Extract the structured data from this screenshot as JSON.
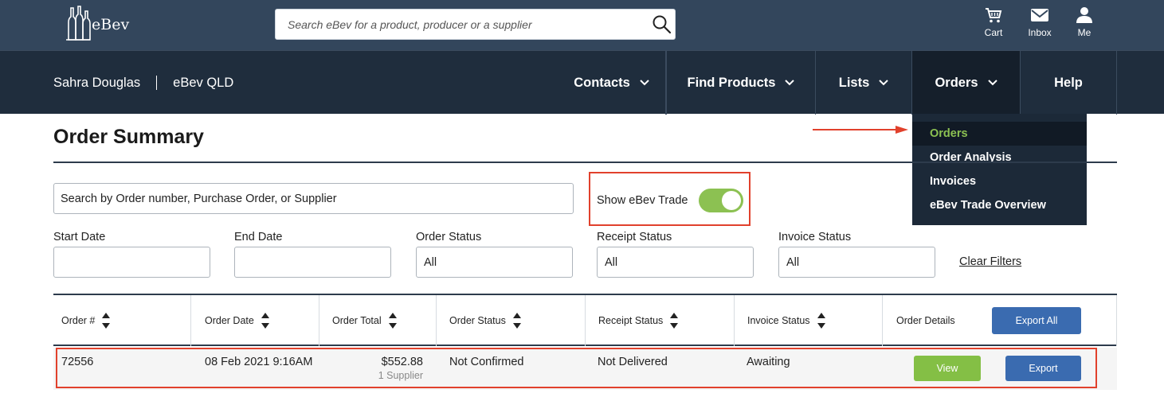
{
  "header": {
    "logo_text": "eBev",
    "search_placeholder": "Search eBev for a product, producer or a supplier",
    "icons": [
      {
        "name": "cart-icon",
        "label": "Cart"
      },
      {
        "name": "inbox-icon",
        "label": "Inbox"
      },
      {
        "name": "me-icon",
        "label": "Me"
      }
    ]
  },
  "nav": {
    "user_name": "Sahra Douglas",
    "company": "eBev QLD",
    "items": [
      {
        "label": "Contacts",
        "has_dropdown": true
      },
      {
        "label": "Find Products",
        "has_dropdown": true
      },
      {
        "label": "Lists",
        "has_dropdown": true
      },
      {
        "label": "Orders",
        "has_dropdown": true,
        "active": true
      },
      {
        "label": "Help",
        "has_dropdown": false
      }
    ],
    "orders_menu": [
      "Orders",
      "Order Analysis",
      "Invoices",
      "eBev Trade Overview"
    ]
  },
  "page": {
    "title": "Order Summary",
    "order_search_placeholder": "Search by Order number, Purchase Order, or Supplier",
    "toggle_label": "Show eBev Trade",
    "toggle_on": true,
    "filters": {
      "start_date_label": "Start Date",
      "start_date_value": "",
      "end_date_label": "End Date",
      "end_date_value": "",
      "order_status_label": "Order Status",
      "order_status_value": "All",
      "receipt_status_label": "Receipt Status",
      "receipt_status_value": "All",
      "invoice_status_label": "Invoice Status",
      "invoice_status_value": "All",
      "clear_label": "Clear Filters"
    }
  },
  "table": {
    "columns": [
      "Order #",
      "Order Date",
      "Order Total",
      "Order Status",
      "Receipt Status",
      "Invoice Status",
      "Order Details"
    ],
    "export_all_label": "Export All",
    "rows": [
      {
        "order_no": "72556",
        "order_date": "08 Feb 2021 9:16AM",
        "order_total": "$552.88",
        "supplier_count": "1 Supplier",
        "order_status": "Not Confirmed",
        "receipt_status": "Not Delivered",
        "invoice_status": "Awaiting",
        "view_label": "View",
        "export_label": "Export"
      }
    ]
  },
  "colors": {
    "header_bg": "#33465c",
    "nav_bg": "#1f2d3d",
    "accent_green": "#8cc152",
    "button_blue": "#3a6bb0",
    "annotation_red": "#e1412c"
  }
}
